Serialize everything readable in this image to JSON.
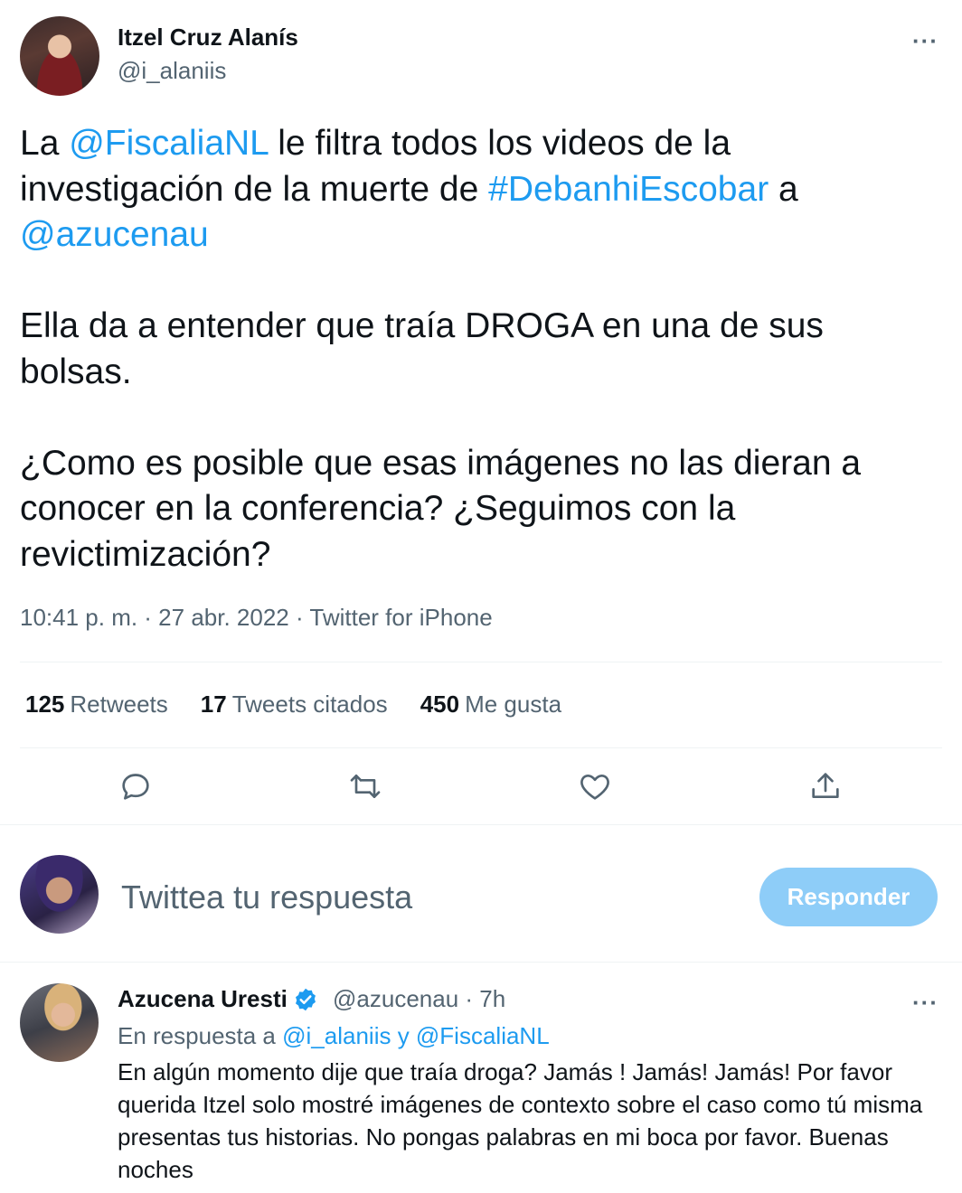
{
  "tweet": {
    "author_name": "Itzel Cruz Alanís",
    "author_handle": "@i_alaniis",
    "more_label": "···",
    "p1": {
      "t1": "La ",
      "mention1": "@FiscaliaNL",
      "t2": " le filtra todos los videos de la investigación de la muerte de ",
      "hashtag": "#DebanhiEscobar",
      "t3": " a ",
      "mention2": "@azucenau"
    },
    "p2": "Ella da a entender que traía DROGA en una de sus bolsas.",
    "p3": "¿Como es posible que esas imágenes no las dieran a conocer en la conferencia? ¿Seguimos con la revictimización?",
    "meta": "10:41 p. m. · 27 abr. 2022 · Twitter for iPhone"
  },
  "stats": {
    "retweets_count": "125",
    "retweets_label": "Retweets",
    "quotes_count": "17",
    "quotes_label": "Tweets citados",
    "likes_count": "450",
    "likes_label": "Me gusta"
  },
  "actions": {
    "icons": [
      "reply-icon",
      "retweet-icon",
      "like-icon",
      "share-icon"
    ],
    "color": "#536471"
  },
  "composer": {
    "placeholder": "Twittea tu respuesta",
    "button_label": "Responder",
    "button_color": "#8ecdf8"
  },
  "reply": {
    "author_name": "Azucena Uresti",
    "author_handle_time": "@azucenau · 7h",
    "more_label": "···",
    "in_reply_prefix": "En respuesta a ",
    "in_reply_users": "@i_alaniis y @FiscaliaNL",
    "text": "En algún momento dije que traía droga? Jamás ! Jamás! Jamás! Por favor querida Itzel solo mostré imágenes de contexto sobre el caso como tú misma presentas tus historias. No pongas palabras en mi boca por favor. Buenas noches"
  },
  "colors": {
    "link": "#1d9bf0",
    "secondary_text": "#536471",
    "verified": "#1d9bf0"
  }
}
